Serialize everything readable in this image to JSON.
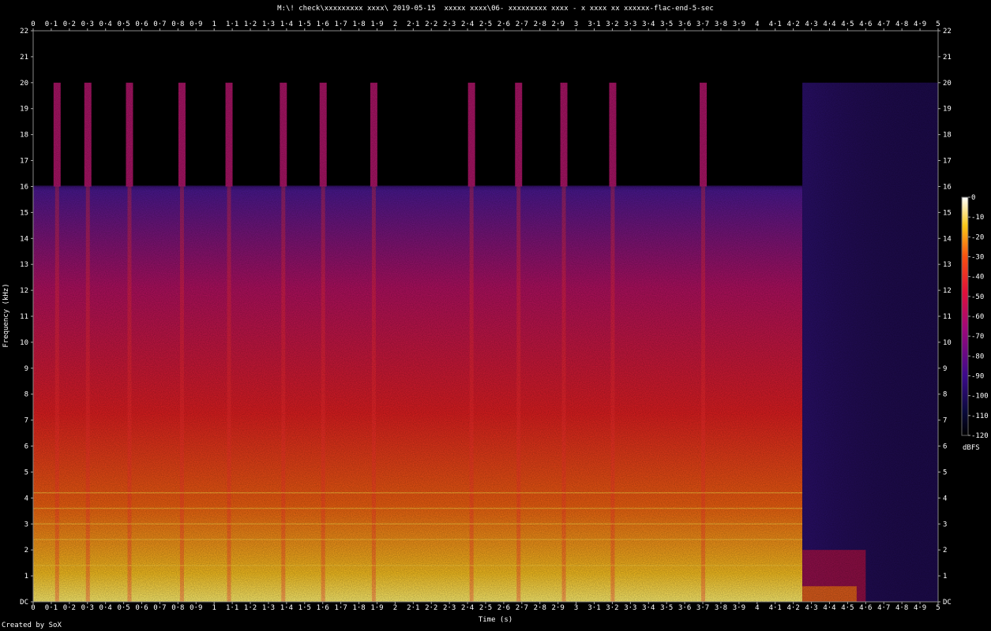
{
  "title": "M:\\! check\\xxxxxxxxx xxxx\\ 2019-05-15  xxxxx xxxx\\06- xxxxxxxxx xxxx - x xxxx xx xxxxxx-flac-end-5-sec",
  "footer": "Created by SoX",
  "colors": {
    "background": "#000000"
  },
  "chart_data": {
    "type": "heatmap",
    "title": "M:\\! check\\xxxxxxxxx xxxx\\ 2019-05-15  xxxxx xxxx\\06- xxxxxxxxx xxxx - x xxxx xx xxxxxx-flac-end-5-sec",
    "xlabel": "Time (s)",
    "ylabel": "Frequency (kHz)",
    "xlim": [
      0,
      5
    ],
    "ylim": [
      0,
      22
    ],
    "x_ticks": [
      "0",
      "0·1",
      "0·2",
      "0·3",
      "0·4",
      "0·5",
      "0·6",
      "0·7",
      "0·8",
      "0·9",
      "1",
      "1·1",
      "1·2",
      "1·3",
      "1·4",
      "1·5",
      "1·6",
      "1·7",
      "1·8",
      "1·9",
      "2",
      "2·1",
      "2·2",
      "2·3",
      "2·4",
      "2·5",
      "2·6",
      "2·7",
      "2·8",
      "2·9",
      "3",
      "3·1",
      "3·2",
      "3·3",
      "3·4",
      "3·5",
      "3·6",
      "3·7",
      "3·8",
      "3·9",
      "4",
      "4·1",
      "4·2",
      "4·3",
      "4·4",
      "4·5",
      "4·6",
      "4·7",
      "4·8",
      "4·9",
      "5"
    ],
    "y_ticks": [
      "DC",
      "1",
      "2",
      "3",
      "4",
      "5",
      "6",
      "7",
      "8",
      "9",
      "10",
      "11",
      "12",
      "13",
      "14",
      "15",
      "16",
      "17",
      "18",
      "19",
      "20",
      "21",
      "22"
    ],
    "colorbar": {
      "label": "dBFS",
      "range": [
        -120,
        0
      ],
      "ticks": [
        "0",
        "-10",
        "-20",
        "-30",
        "-40",
        "-50",
        "-60",
        "-70",
        "-80",
        "-90",
        "-100",
        "-110",
        "-120"
      ]
    },
    "features": {
      "lowpass_cutoff_khz": 16,
      "transients_s": [
        0.13,
        0.3,
        0.53,
        0.82,
        1.08,
        1.38,
        1.6,
        1.88,
        2.42,
        2.68,
        2.93,
        3.2,
        3.7
      ],
      "music_end_s": 4.25,
      "noise_band_khz": [
        0,
        20
      ]
    }
  }
}
